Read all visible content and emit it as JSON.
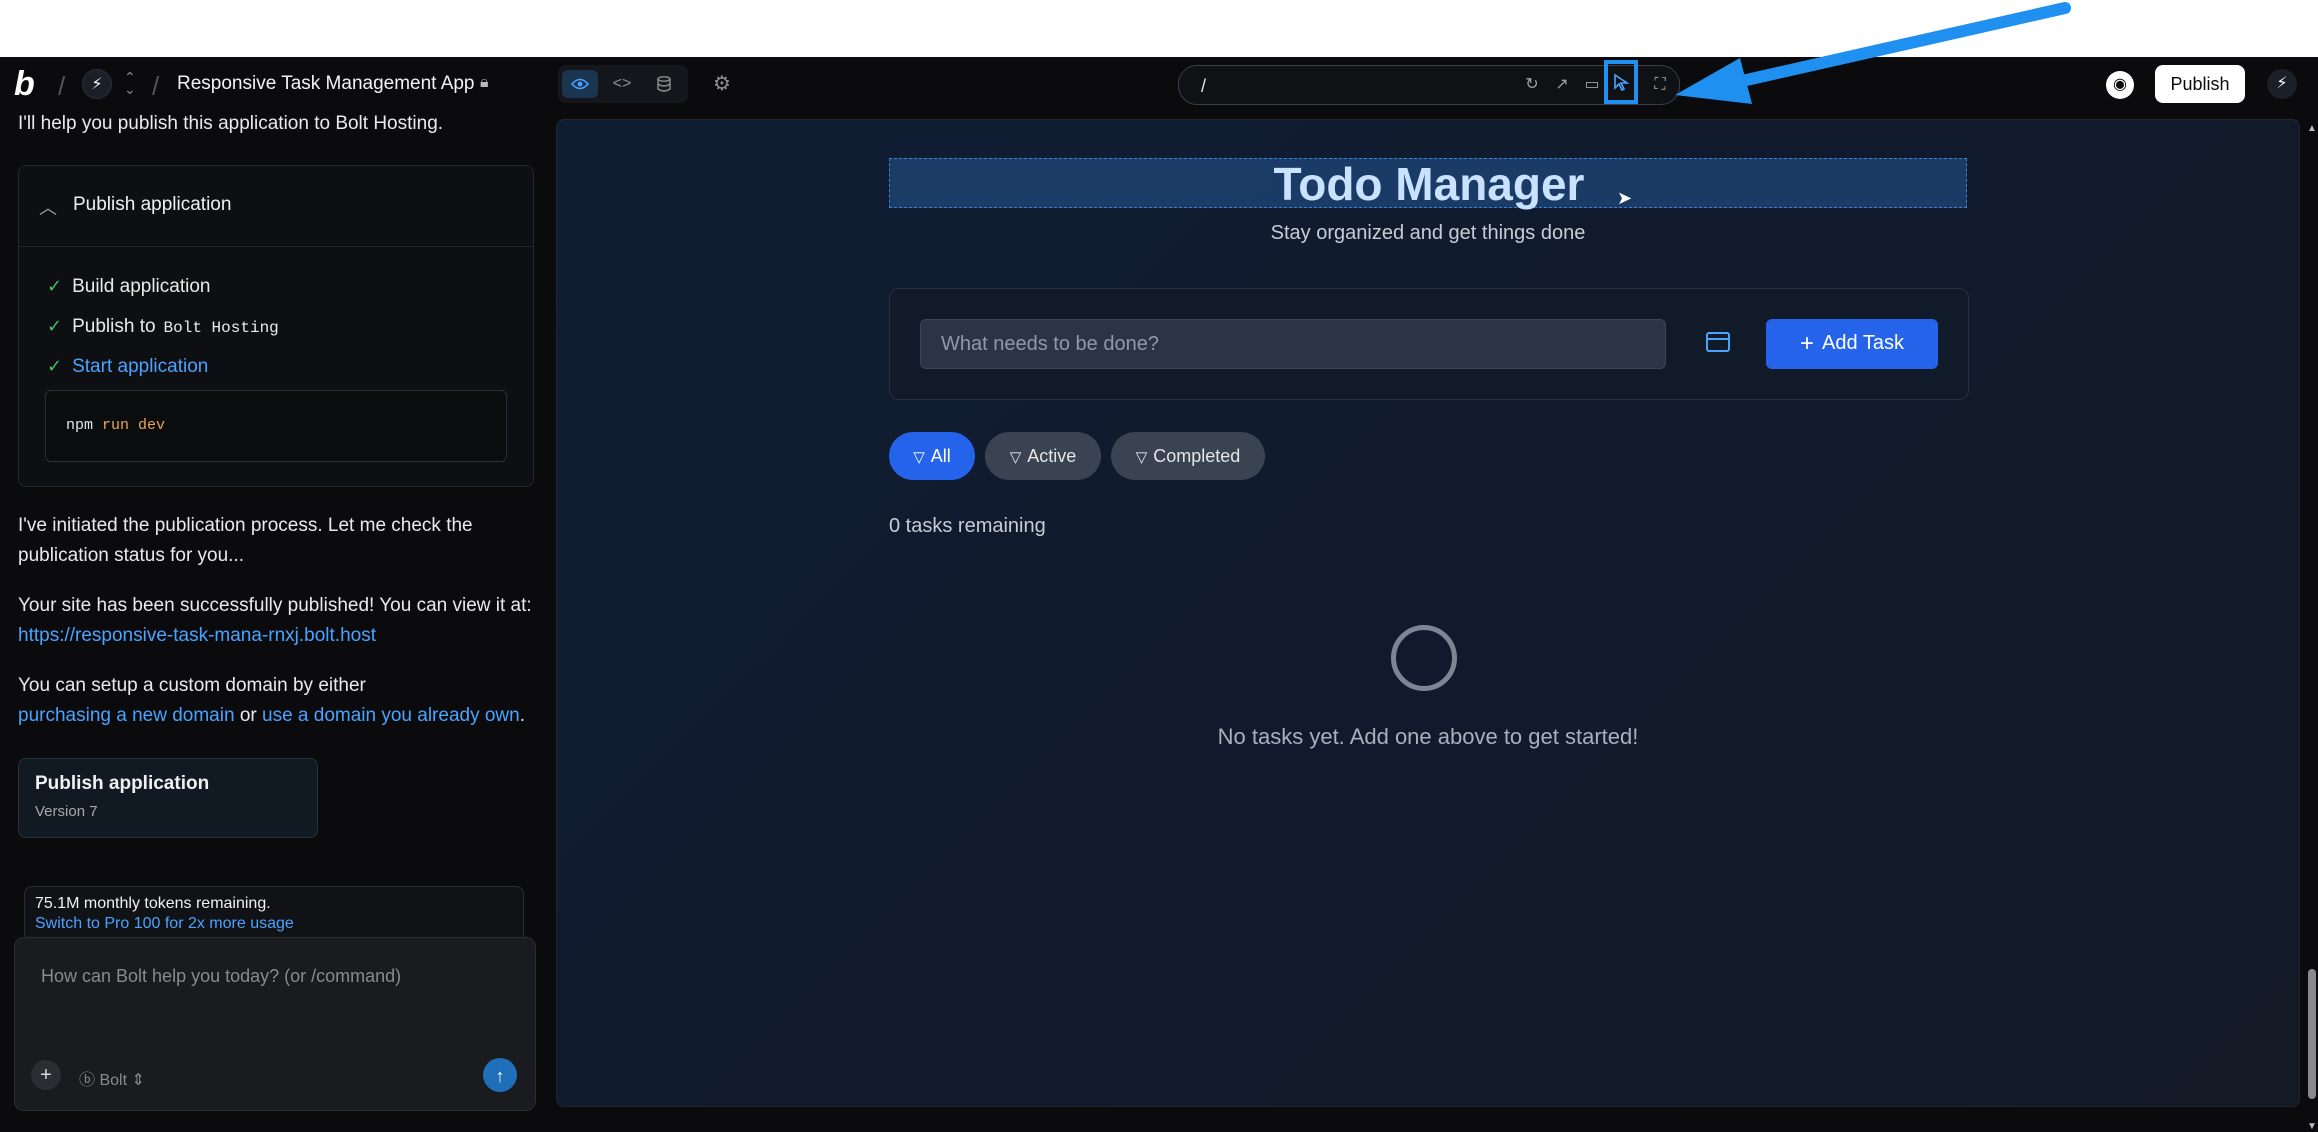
{
  "header": {
    "project_title": "Responsive Task Management App",
    "publish_label": "Publish"
  },
  "urlbar": {
    "value": "/"
  },
  "chat": {
    "intro": "I'll help you publish this application to Bolt Hosting.",
    "publish_card": {
      "title": "Publish application",
      "steps": [
        {
          "label": "Build application"
        },
        {
          "label": "Publish to",
          "code": "Bolt Hosting"
        },
        {
          "label": "Start application"
        }
      ],
      "command": {
        "cmd": "npm",
        "rest": "run dev"
      }
    },
    "para1": "I've initiated the publication process. Let me check the publication status for you...",
    "para2_text": "Your site has been successfully published! You can view it at:",
    "para2_link": "https://responsive-task-mana-rnxj.bolt.host",
    "para3_text": "You can setup a custom domain by either",
    "para3_link1": "purchasing a new domain",
    "para3_or": "or",
    "para3_link2": "use a domain you already own",
    "para3_end": ".",
    "artifact": {
      "title": "Publish application",
      "subtitle": "Version 7"
    },
    "tokens": {
      "remaining": "75.1M monthly tokens remaining.",
      "upgrade_link": "Switch to Pro 100 for 2x more usage"
    },
    "composer": {
      "placeholder": "How can Bolt help you today? (or /command)",
      "model": "Bolt"
    }
  },
  "preview": {
    "title": "Todo Manager",
    "subtitle": "Stay organized and get things done",
    "input_placeholder": "What needs to be done?",
    "add_button": "Add Task",
    "filters": {
      "all": "All",
      "active": "Active",
      "completed": "Completed"
    },
    "remaining": "0 tasks remaining",
    "empty_message": "No tasks yet. Add one above to get started!"
  },
  "colors": {
    "accent": "#2563eb",
    "link": "#4aa3ff",
    "annotation_arrow": "#1f8ff0",
    "success": "#39c26b"
  }
}
